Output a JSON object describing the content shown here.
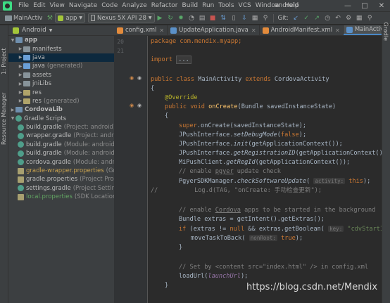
{
  "window": {
    "title": "android"
  },
  "menu": [
    "File",
    "Edit",
    "View",
    "Navigate",
    "Code",
    "Analyze",
    "Refactor",
    "Build",
    "Run",
    "Tools",
    "VCS",
    "Window",
    "Help"
  ],
  "toolbar": {
    "project_label": "MainActiv",
    "config": "app",
    "device": "Nexus 5X API 28",
    "git_label": "Git:"
  },
  "stripes": {
    "project": "1: Project",
    "resource_manager": "Resource Manager",
    "gradle": "Gradle"
  },
  "panel": {
    "view_mode": "Android"
  },
  "tree": [
    {
      "label": "app",
      "tag": "",
      "level": 0,
      "icon": "module",
      "bold": true
    },
    {
      "label": "manifests",
      "tag": "",
      "level": 1,
      "icon": "folder"
    },
    {
      "label": "java",
      "tag": "",
      "level": 1,
      "icon": "folder-blue",
      "selected": true
    },
    {
      "label": "java",
      "tag": "(generated)",
      "level": 1,
      "icon": "folder-blue"
    },
    {
      "label": "assets",
      "tag": "",
      "level": 1,
      "icon": "folder"
    },
    {
      "label": "jniLibs",
      "tag": "",
      "level": 1,
      "icon": "folder"
    },
    {
      "label": "res",
      "tag": "",
      "level": 1,
      "icon": "folder-res"
    },
    {
      "label": "res",
      "tag": "(generated)",
      "level": 1,
      "icon": "folder-res"
    },
    {
      "label": "CordovaLib",
      "tag": "",
      "level": 0,
      "icon": "module",
      "bold": true
    },
    {
      "label": "Gradle Scripts",
      "tag": "",
      "level": 0,
      "icon": "gradle"
    },
    {
      "label": "build.gradle",
      "tag": "(Project: android)",
      "level": 1,
      "icon": "gradle"
    },
    {
      "label": "wrapper.gradle",
      "tag": "(Project: android)",
      "level": 1,
      "icon": "gradle"
    },
    {
      "label": "build.gradle",
      "tag": "(Module: android)",
      "level": 1,
      "icon": "gradle"
    },
    {
      "label": "build.gradle",
      "tag": "(Module: android)",
      "level": 1,
      "icon": "gradle"
    },
    {
      "label": "cordova.gradle",
      "tag": "(Module: android)",
      "level": 1,
      "icon": "gradle"
    },
    {
      "label": "gradle-wrapper.properties",
      "tag": "(Gra",
      "level": 1,
      "icon": "props",
      "color": "orange"
    },
    {
      "label": "gradle.properties",
      "tag": "(Project Prop",
      "level": 1,
      "icon": "props"
    },
    {
      "label": "settings.gradle",
      "tag": "(Project Settings",
      "level": 1,
      "icon": "gradle"
    },
    {
      "label": "local.properties",
      "tag": "(SDK Location)",
      "level": 1,
      "icon": "props",
      "color": "green"
    }
  ],
  "tabs": [
    {
      "label": "config.xml",
      "active": false
    },
    {
      "label": "UpdateApplication.java",
      "active": false
    },
    {
      "label": "AndroidManifest.xml",
      "active": false
    },
    {
      "label": "MainActivity.java",
      "active": true
    }
  ],
  "line_numbers": [
    "20",
    "21",
    "",
    "",
    "",
    "",
    "",
    "",
    "",
    "",
    "",
    "",
    "",
    "",
    "",
    "",
    "",
    "",
    "",
    "",
    "",
    "",
    "",
    "",
    "",
    ""
  ],
  "code": {
    "l1": "package com.mendix.myapp;",
    "l2_kw": "import",
    "l2_fold": "...",
    "l3_kw1": "public class",
    "l3_name": " MainActivity ",
    "l3_kw2": "extends",
    "l3_rest": " CordovaActivity",
    "l4": "{",
    "l5": "@Override",
    "l6_kw": "public void",
    "l6_fn": "onCreate",
    "l6_rest": "(Bundle savedInstanceState)",
    "l7": "{",
    "l8_kw": "super",
    "l8_rest": ".onCreate(savedInstanceState);",
    "l9_a": "JPushInterface.",
    "l9_b": "setDebugMode",
    "l9_c": "(",
    "l9_d": "false",
    "l9_e": ");",
    "l10_a": "JPushInterface.",
    "l10_b": "init",
    "l10_c": "(getApplicationContext());",
    "l11_a": "JPushInterface.",
    "l11_b": "getRegistrationID",
    "l11_c": "(getApplicationContext());",
    "l12_a": "MiPushClient.",
    "l12_b": "getRegId",
    "l12_c": "(getApplicationContext());",
    "l13_a": "// enable ",
    "l13_b": "pgyer",
    "l13_c": " update check",
    "l14_a": "PgyerSDKManager.",
    "l14_b": "checkSoftwareUpdate",
    "l14_c": "( ",
    "l14_hint": "activity:",
    "l14_d": " this",
    "l14_e": ");",
    "l15": "//          Log.d(TAG, \"onCreate: 手动检查更新\");",
    "l16_a": "// enable ",
    "l16_b": "Cordova",
    "l16_c": " apps to be started in the background",
    "l17": "Bundle extras = getIntent().getExtras();",
    "l18_kw": "if",
    "l18_a": " (extras != ",
    "l18_null": "null",
    "l18_b": " && extras.getBoolean( ",
    "l18_hint": "key:",
    "l18_str": " \"cdvStartInBac",
    "l19_a": "moveTaskToBack( ",
    "l19_hint": "nonRoot:",
    "l19_kw": " true",
    "l19_b": ");",
    "l20": "}",
    "l21": "// Set by <content src=\"index.html\" /> in config.xml",
    "l22_a": "loadUrl(",
    "l22_b": "launchUrl",
    "l22_c": ");",
    "l23": "}"
  },
  "watermark": "https://blog.csdn.net/Mendix"
}
